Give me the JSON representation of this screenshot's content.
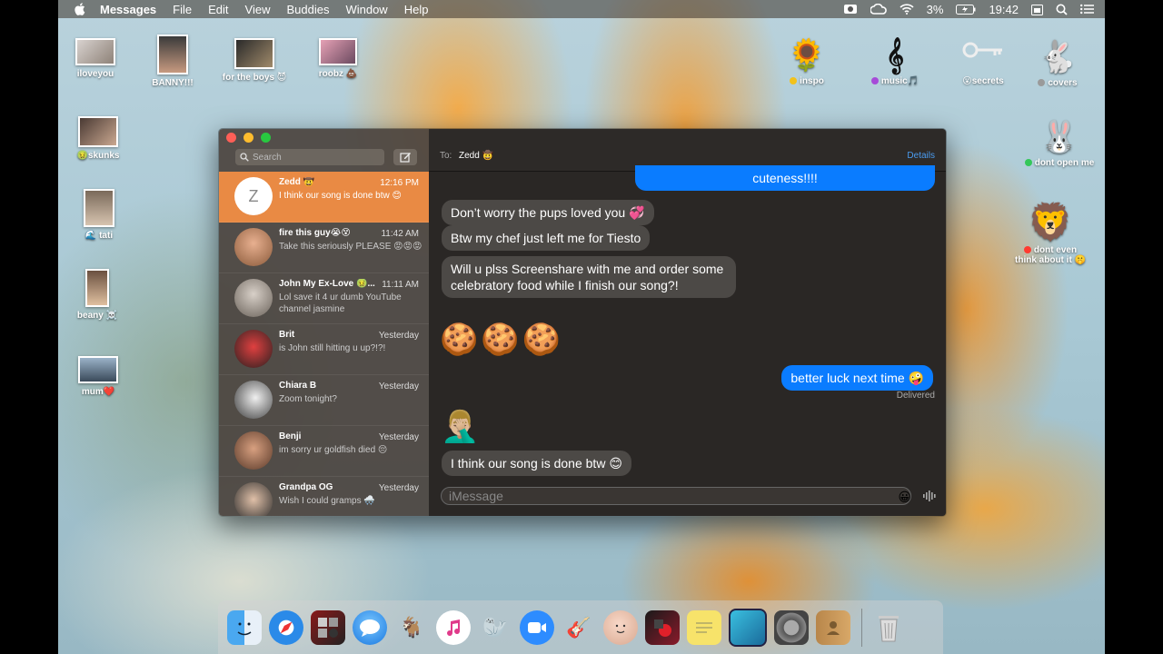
{
  "menubar": {
    "app_name": "Messages",
    "items": [
      "File",
      "Edit",
      "View",
      "Buddies",
      "Window",
      "Help"
    ],
    "battery": "3%",
    "clock": "19:42"
  },
  "desktop_icons": [
    {
      "label": "iloveyou",
      "dot": ""
    },
    {
      "label": "BANNY!!!",
      "dot": ""
    },
    {
      "label": "for the boys 😈",
      "dot": ""
    },
    {
      "label": "roobz 💩",
      "dot": ""
    },
    {
      "label": "inspo",
      "dot": "#f2c21b"
    },
    {
      "label": "music🎵",
      "dot": "#a64bd8"
    },
    {
      "label": "😮secrets",
      "dot": ""
    },
    {
      "label": "covers",
      "dot": "#9a9a9a"
    },
    {
      "label": "🤢skunks",
      "dot": ""
    },
    {
      "label": "🌊 tati",
      "dot": ""
    },
    {
      "label": "beany ☠️",
      "dot": ""
    },
    {
      "label": "mum❤️",
      "dot": ""
    },
    {
      "label": "dont open me",
      "dot": "#34c759"
    },
    {
      "label": "dont even think about it 🤫",
      "dot": "#ff3b30"
    }
  ],
  "sidebar": {
    "search_placeholder": "Search",
    "conversations": [
      {
        "name": "Zedd 🤠",
        "time": "12:16 PM",
        "preview": "I think our song is done btw 😊",
        "initial": "Z",
        "active": true
      },
      {
        "name": "fire this guy😭😵",
        "time": "11:42 AM",
        "preview": "Take this seriously PLEASE 😡😡😡",
        "active": false
      },
      {
        "name": "John My Ex-Love 🤢...",
        "time": "11:11 AM",
        "preview": "Lol save it 4 ur dumb YouTube channel jasmine",
        "active": false
      },
      {
        "name": "Brit",
        "time": "Yesterday",
        "preview": "is John still hitting u up?!?!",
        "active": false
      },
      {
        "name": "Chiara B",
        "time": "Yesterday",
        "preview": "Zoom tonight?",
        "active": false
      },
      {
        "name": "Benji",
        "time": "Yesterday",
        "preview": "im sorry ur goldfish died 😔",
        "active": false
      },
      {
        "name": "Grandpa OG",
        "time": "Yesterday",
        "preview": "Wish I could gramps 🌨️",
        "active": false
      }
    ]
  },
  "chat": {
    "to_label": "To:",
    "recipient": "Zedd 🤠",
    "details_label": "Details",
    "messages": [
      {
        "text": "cuteness!!!!",
        "dir": "out"
      },
      {
        "text": "Don’t worry the pups loved you 💞",
        "dir": "in"
      },
      {
        "text": "Btw my chef just left me for Tiesto",
        "dir": "in"
      },
      {
        "text": "Will u plss Screenshare with me and order some celebratory food while I finish our song?!",
        "dir": "in"
      },
      {
        "text": "🍪🍪🍪",
        "dir": "in"
      },
      {
        "text": "better luck next time 🤪",
        "dir": "out"
      },
      {
        "text": "🤦🏼‍♂️",
        "dir": "in"
      },
      {
        "text": "I think our song is done btw 😊",
        "dir": "in"
      }
    ],
    "delivered_label": "Delivered",
    "input_placeholder": "iMessage"
  },
  "dock": {
    "apps": [
      "finder-icon",
      "safari-icon",
      "photo-booth-icon",
      "messages-icon",
      "goat-icon",
      "itunes-icon",
      "seal-icon",
      "zoom-icon",
      "garageband-icon",
      "face-icon",
      "photobooth-red-icon",
      "stickies-icon",
      "preview-icon",
      "system-preferences-icon",
      "contacts-icon",
      "trash-icon"
    ]
  }
}
